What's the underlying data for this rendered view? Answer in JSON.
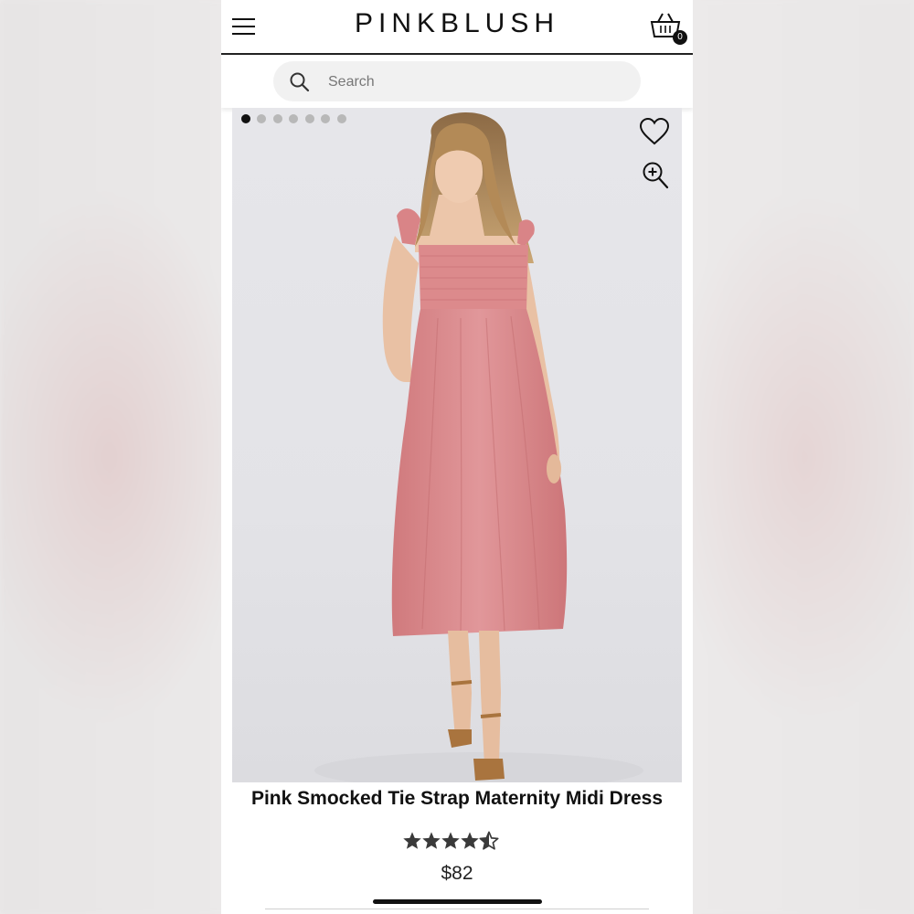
{
  "header": {
    "logo": "PINKBLUSH",
    "cart_count": "0"
  },
  "search": {
    "placeholder": "Search"
  },
  "gallery": {
    "total_images": 7,
    "active_index": 0
  },
  "product": {
    "title": "Pink Smocked Tie Strap Maternity Midi Dress",
    "rating": 4.5,
    "rating_max": 5,
    "price": "$82"
  },
  "icons": {
    "menu": "hamburger-menu-icon",
    "cart": "shopping-basket-icon",
    "search": "search-icon",
    "wishlist": "heart-icon",
    "zoom": "zoom-in-icon",
    "star": "star-icon"
  },
  "colors": {
    "dress": "#dc8a8c",
    "text": "#111111",
    "star": "#3a3a3a"
  }
}
